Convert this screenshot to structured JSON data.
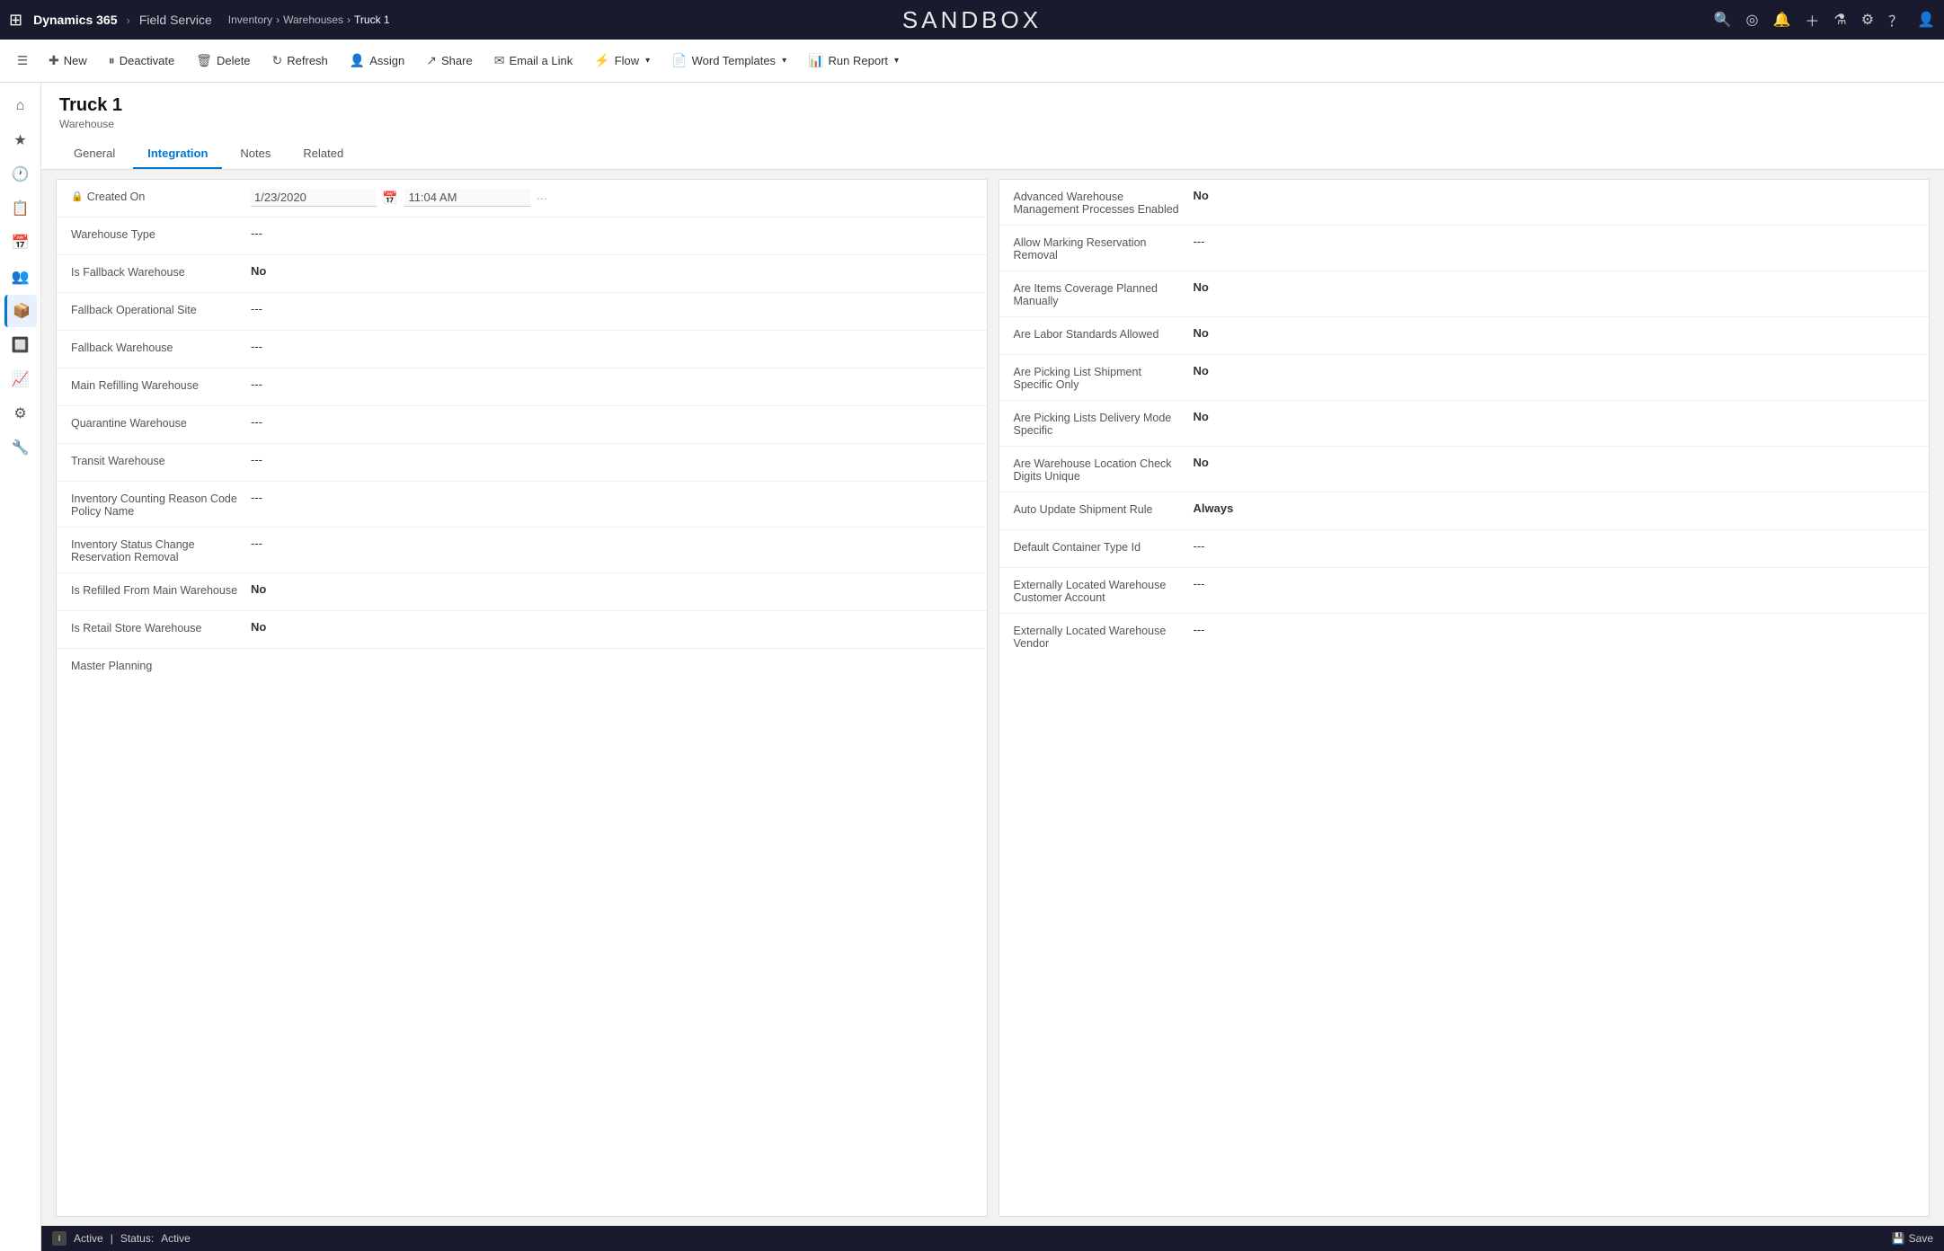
{
  "topNav": {
    "waffle": "⊞",
    "appName": "Dynamics 365",
    "chevron": "▾",
    "module": "Field Service",
    "breadcrumb": [
      "Inventory",
      "Warehouses",
      "Truck 1"
    ],
    "sandboxLabel": "SANDBOX",
    "icons": {
      "search": "🔍",
      "target": "◎",
      "bell": "♔",
      "plus": "+",
      "filter": "⚗",
      "gear": "⚙",
      "help": "?",
      "user": "👤"
    }
  },
  "toolbar": {
    "collapseIcon": "☰",
    "buttons": [
      {
        "id": "new",
        "label": "New",
        "icon": "+"
      },
      {
        "id": "deactivate",
        "label": "Deactivate",
        "icon": "⏸"
      },
      {
        "id": "delete",
        "label": "Delete",
        "icon": "🗑"
      },
      {
        "id": "refresh",
        "label": "Refresh",
        "icon": "↻"
      },
      {
        "id": "assign",
        "label": "Assign",
        "icon": "👤"
      },
      {
        "id": "share",
        "label": "Share",
        "icon": "↗"
      },
      {
        "id": "email-link",
        "label": "Email a Link",
        "icon": "✉"
      },
      {
        "id": "flow",
        "label": "Flow",
        "icon": "⚡",
        "hasDropdown": true
      },
      {
        "id": "word-templates",
        "label": "Word Templates",
        "icon": "📄",
        "hasDropdown": true
      },
      {
        "id": "run-report",
        "label": "Run Report",
        "icon": "📊",
        "hasDropdown": true
      }
    ]
  },
  "sideNav": {
    "items": [
      {
        "id": "home",
        "icon": "⌂",
        "label": "Home"
      },
      {
        "id": "favorites",
        "icon": "★",
        "label": "Favorites"
      },
      {
        "id": "recent",
        "icon": "🕐",
        "label": "Recent"
      },
      {
        "id": "notes",
        "icon": "📋",
        "label": "Notes"
      },
      {
        "id": "calendar",
        "icon": "📅",
        "label": "Calendar"
      },
      {
        "id": "contacts",
        "icon": "👥",
        "label": "Contacts"
      },
      {
        "id": "inventory",
        "icon": "📦",
        "label": "Inventory",
        "active": true
      },
      {
        "id": "products",
        "icon": "🔲",
        "label": "Products"
      },
      {
        "id": "reports",
        "icon": "📈",
        "label": "Reports"
      },
      {
        "id": "settings",
        "icon": "⚙",
        "label": "Settings"
      },
      {
        "id": "tools",
        "icon": "🔧",
        "label": "Tools"
      }
    ]
  },
  "record": {
    "title": "Truck 1",
    "subtitle": "Warehouse",
    "tabs": [
      {
        "id": "general",
        "label": "General"
      },
      {
        "id": "integration",
        "label": "Integration",
        "active": true
      },
      {
        "id": "notes",
        "label": "Notes"
      },
      {
        "id": "related",
        "label": "Related"
      }
    ]
  },
  "leftSection": {
    "fields": [
      {
        "id": "created-on",
        "label": "Created On",
        "hasLock": true,
        "dateValue": "1/23/2020",
        "timeValue": "11:04 AM",
        "ellipsis": true
      },
      {
        "id": "warehouse-type",
        "label": "Warehouse Type",
        "value": "---"
      },
      {
        "id": "is-fallback-warehouse",
        "label": "Is Fallback Warehouse",
        "value": "No",
        "bold": true
      },
      {
        "id": "fallback-operational-site",
        "label": "Fallback Operational Site",
        "value": "---"
      },
      {
        "id": "fallback-warehouse",
        "label": "Fallback Warehouse",
        "value": "---"
      },
      {
        "id": "main-refilling-warehouse",
        "label": "Main Refilling Warehouse",
        "value": "---"
      },
      {
        "id": "quarantine-warehouse",
        "label": "Quarantine Warehouse",
        "value": "---"
      },
      {
        "id": "transit-warehouse",
        "label": "Transit Warehouse",
        "value": "---"
      },
      {
        "id": "inventory-counting-reason-code",
        "label": "Inventory Counting Reason Code Policy Name",
        "value": "---"
      },
      {
        "id": "inventory-status-change",
        "label": "Inventory Status Change Reservation Removal",
        "value": "---"
      },
      {
        "id": "is-refilled-from-main",
        "label": "Is Refilled From Main Warehouse",
        "value": "No",
        "bold": true
      },
      {
        "id": "is-retail-store",
        "label": "Is Retail Store Warehouse",
        "value": "No",
        "bold": true
      },
      {
        "id": "master-planning",
        "label": "Master Planning",
        "value": ""
      }
    ]
  },
  "rightSection": {
    "fields": [
      {
        "id": "advanced-warehouse-mgmt",
        "label": "Advanced Warehouse Management Processes Enabled",
        "value": "No",
        "bold": true
      },
      {
        "id": "allow-marking-reservation",
        "label": "Allow Marking Reservation Removal",
        "value": "---"
      },
      {
        "id": "are-items-coverage",
        "label": "Are Items Coverage Planned Manually",
        "value": "No",
        "bold": true
      },
      {
        "id": "are-labor-standards",
        "label": "Are Labor Standards Allowed",
        "value": "No",
        "bold": true
      },
      {
        "id": "are-picking-list-shipment",
        "label": "Are Picking List Shipment Specific Only",
        "value": "No",
        "bold": true
      },
      {
        "id": "are-picking-lists-delivery",
        "label": "Are Picking Lists Delivery Mode Specific",
        "value": "No",
        "bold": true
      },
      {
        "id": "are-warehouse-location",
        "label": "Are Warehouse Location Check Digits Unique",
        "value": "No",
        "bold": true
      },
      {
        "id": "auto-update-shipment",
        "label": "Auto Update Shipment Rule",
        "value": "Always",
        "bold": true
      },
      {
        "id": "default-container-type",
        "label": "Default Container Type Id",
        "value": "---"
      },
      {
        "id": "externally-located-customer",
        "label": "Externally Located Warehouse Customer Account",
        "value": "---"
      },
      {
        "id": "externally-located-vendor",
        "label": "Externally Located Warehouse Vendor",
        "value": "---"
      }
    ]
  },
  "statusBar": {
    "indicator": "I",
    "statusLabel": "Active",
    "statusSeparator": "|",
    "statusKey": "Status:",
    "statusValue": "Active",
    "saveLabel": "Save"
  }
}
